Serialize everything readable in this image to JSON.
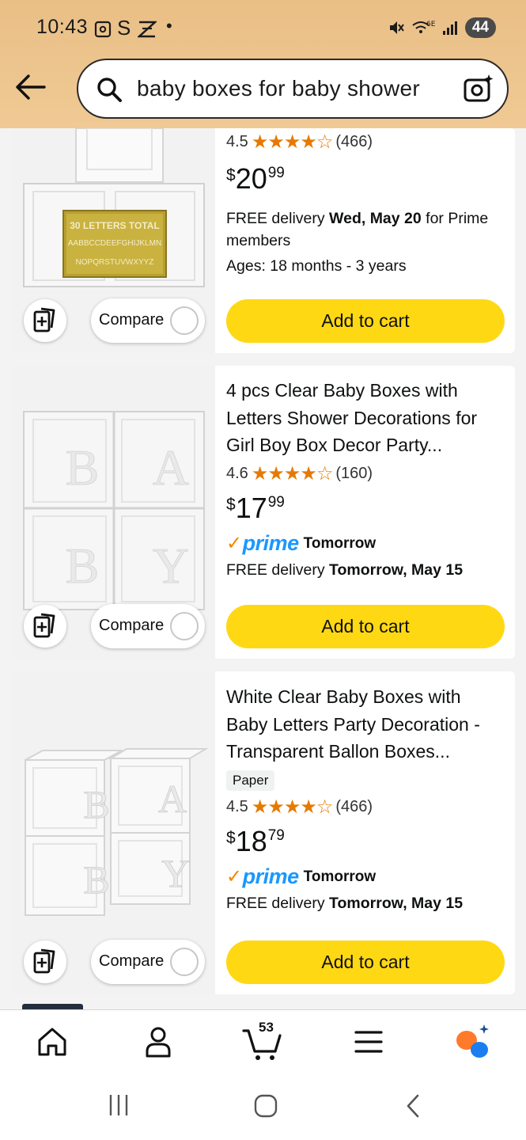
{
  "status_bar": {
    "time": "10:43",
    "icons_left": [
      "screenshot-icon",
      "s-icon",
      "mail-icon",
      "dot-icon"
    ],
    "network": "6E",
    "battery": "44"
  },
  "search": {
    "query": "baby boxes for baby shower"
  },
  "products": [
    {
      "image_text": "30 LETTERS TOTAL",
      "image_subtext": "AABBCCDEEFGHIJKLMN",
      "image_subtext2": "NOPQRSTUVWXYYZ",
      "rating": "4.5",
      "stars": "★★★★☆",
      "review_count": "(466)",
      "price_symbol": "$",
      "price_whole": "20",
      "price_fraction": "99",
      "delivery_prefix": "FREE delivery ",
      "delivery_date": "Wed, May 20",
      "delivery_suffix": " for Prime members",
      "ages": "Ages: 18 months - 3 years",
      "compare_label": "Compare",
      "cart_label": "Add to cart"
    },
    {
      "title": "4 pcs Clear Baby Boxes with Letters Shower Decorations for Girl Boy Box Decor Party...",
      "rating": "4.6",
      "stars": "★★★★☆",
      "review_count": "(160)",
      "price_symbol": "$",
      "price_whole": "17",
      "price_fraction": "99",
      "prime_label": "prime",
      "prime_day": "Tomorrow",
      "delivery_prefix": "FREE delivery ",
      "delivery_date": "Tomorrow, May 15",
      "compare_label": "Compare",
      "cart_label": "Add to cart"
    },
    {
      "title": "White Clear Baby Boxes with Baby Letters Party Decoration - Transparent Ballon Boxes...",
      "badge": "Paper",
      "rating": "4.5",
      "stars": "★★★★☆",
      "review_count": "(466)",
      "price_symbol": "$",
      "price_whole": "18",
      "price_fraction": "79",
      "prime_label": "prime",
      "prime_day": "Tomorrow",
      "delivery_prefix": "FREE delivery ",
      "delivery_date": "Tomorrow, May 15",
      "compare_label": "Compare",
      "cart_label": "Add to cart"
    }
  ],
  "bottom_nav": {
    "items": [
      "home-icon",
      "account-icon",
      "cart-icon",
      "menu-icon",
      "rufus-icon"
    ],
    "cart_count": "53"
  },
  "colors": {
    "header": "#edc58f",
    "cart_button": "#ffd814",
    "star": "#e67a00",
    "prime_blue": "#1a98ff"
  }
}
